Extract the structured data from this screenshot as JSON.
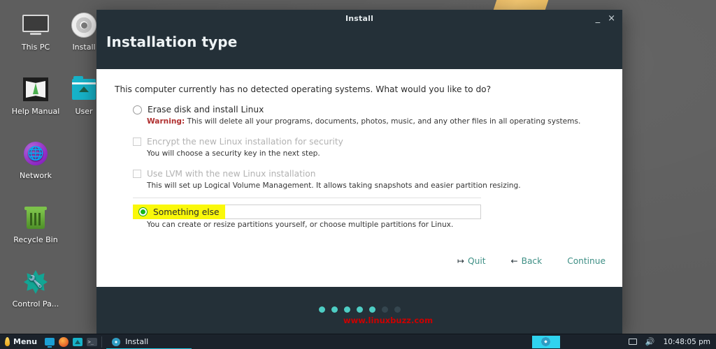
{
  "desktop": {
    "icons": [
      {
        "label": "This PC",
        "icon": "monitor-icon"
      },
      {
        "label": "Install",
        "icon": "disc-icon"
      },
      {
        "label": "Help Manual",
        "icon": "book-icon"
      },
      {
        "label": "User",
        "icon": "folder-home-icon"
      },
      {
        "label": "Network",
        "icon": "globe-icon"
      },
      {
        "label": "Recycle Bin",
        "icon": "trash-icon"
      },
      {
        "label": "Control Pa...",
        "icon": "gear-wrench-icon"
      }
    ],
    "background_color": "#5e5e5e"
  },
  "installer": {
    "window_title": "Install",
    "minimize_label": "_",
    "close_label": "×",
    "heading": "Installation type",
    "prompt": "This computer currently has no detected operating systems. What would you like to do?",
    "options": [
      {
        "type": "radio",
        "label": "Erase disk and install Linux",
        "selected": false,
        "enabled": true,
        "warning_prefix": "Warning:",
        "description": "This will delete all your programs, documents, photos, music, and any other files in all operating systems."
      },
      {
        "type": "checkbox",
        "label": "Encrypt the new Linux installation for security",
        "selected": false,
        "enabled": false,
        "description": "You will choose a security key in the next step."
      },
      {
        "type": "checkbox",
        "label": "Use LVM with the new Linux installation",
        "selected": false,
        "enabled": false,
        "description": "This will set up Logical Volume Management. It allows taking snapshots and easier partition resizing."
      },
      {
        "type": "radio",
        "label": "Something else",
        "selected": true,
        "enabled": true,
        "highlighted": true,
        "description": "You can create or resize partitions yourself, or choose multiple partitions for Linux."
      }
    ],
    "watermark": "www.linuxbuzz.com",
    "buttons": {
      "quit": "Quit",
      "quit_icon": "↦",
      "back": "Back",
      "back_icon": "←",
      "continue": "Continue"
    },
    "progress_dots": {
      "total": 7,
      "active": 5
    },
    "colors": {
      "header_bg": "#243038",
      "accent_teal": "#3e8f85",
      "dot_active": "#4ecdc4",
      "dot_inactive": "#35464f",
      "highlight_yellow": "#faf80a",
      "radio_green": "#17b51a",
      "warning_red": "#b03030",
      "watermark_red": "#cc0000"
    }
  },
  "taskbar": {
    "menu_label": "Menu",
    "quick_launch": [
      "monitor-icon",
      "firefox-icon",
      "file-manager-icon",
      "terminal-icon"
    ],
    "task_label": "Install",
    "tray": {
      "display_icon": "display-icon",
      "volume_icon": "🔊",
      "clock": "10:48:05 pm"
    }
  }
}
